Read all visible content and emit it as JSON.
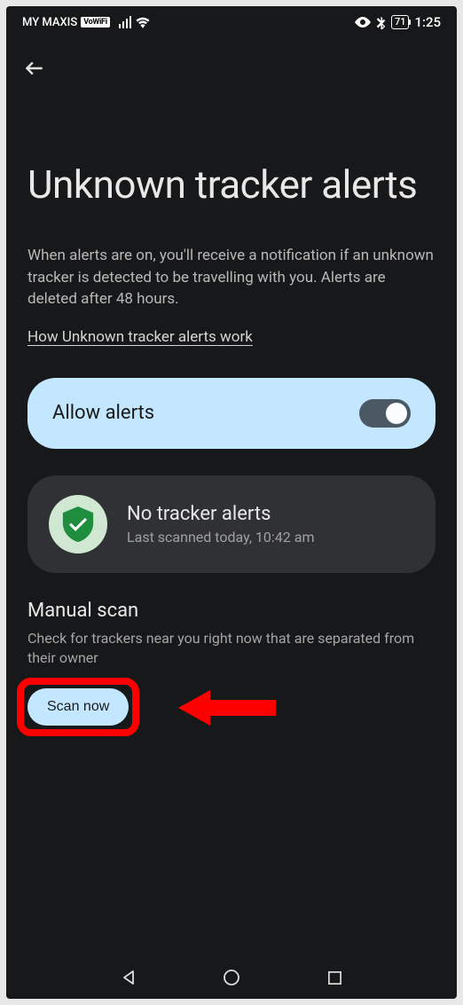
{
  "status_bar": {
    "carrier": "MY MAXIS",
    "vowifi": "VoWiFi",
    "battery": "71",
    "time": "1:25"
  },
  "page": {
    "title": "Unknown tracker alerts",
    "description": "When alerts are on, you'll receive a notification if an unknown tracker is detected to be travelling with you. Alerts are deleted after 48 hours.",
    "link": "How Unknown tracker alerts work"
  },
  "allow_card": {
    "label": "Allow alerts",
    "enabled": true
  },
  "status_card": {
    "title": "No tracker alerts",
    "subtitle": "Last scanned today, 10:42 am"
  },
  "manual_scan": {
    "title": "Manual scan",
    "description": "Check for trackers near you right now that are separated from their owner",
    "button": "Scan now"
  }
}
